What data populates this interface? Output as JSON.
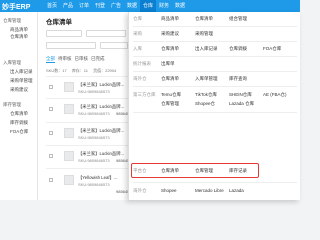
{
  "topbar": {
    "logo": "妙手ERP",
    "nav": [
      "首页",
      "产品",
      "订单",
      "刊登",
      "广告",
      "数据",
      "仓库",
      "财务",
      "数据"
    ]
  },
  "sidebar": {
    "groups": [
      {
        "label": "仓库管理",
        "items": [
          "商品清单",
          "仓库清单"
        ]
      },
      {
        "label": "入库管理",
        "items": [
          "出入库记录",
          "采购单管理",
          "采购建议"
        ]
      },
      {
        "label": "库存管理",
        "items": [
          "仓库清单",
          "库存调拨",
          "FOA仓库"
        ]
      }
    ]
  },
  "main": {
    "title": "仓库清单",
    "tabs": [
      "全部",
      "待审核",
      "已审核",
      "已完成"
    ],
    "stats": [
      "SKU数：17",
      "库存：11",
      "货值：22904"
    ],
    "products": [
      {
        "title": "【米兰家】Luckin品牌...",
        "sku": "SKU:9809846573",
        "value": "9856457155"
      },
      {
        "title": "【米兰家】Luckin品牌...",
        "sku": "SKU:9809846573",
        "value": "9856457155"
      },
      {
        "title": "【米兰家】Luckin品牌...",
        "sku": "SKU:9809846573",
        "value": "9856457155"
      },
      {
        "title": "【米兰家】Luckin品牌...",
        "sku": "SKU:9809846573",
        "value": "9856457155"
      },
      {
        "title": "【Yellowish Leaf】...",
        "sku": "SKU:9809846573",
        "value": "9856457155"
      }
    ]
  },
  "dropdown": {
    "sections": [
      {
        "category": "仓库",
        "items": [
          "商品清单",
          "仓库清单",
          "组合管理"
        ]
      },
      {
        "category": "采购",
        "items": [
          "采购建议",
          "采购管理"
        ]
      },
      {
        "category": "入库",
        "items": [
          "仓库清单",
          "出入库记录",
          "仓库调拨",
          "FOA仓库"
        ]
      },
      {
        "category": "统计报表",
        "items": [
          "出库单"
        ]
      },
      {
        "category": "海外仓",
        "items": [
          "仓库清单",
          "入库单管理",
          "库存查询"
        ]
      },
      {
        "category": "第三方仓库",
        "items": [
          "Temu仓库",
          "TikTok仓库",
          "SHEIN仓库",
          "AE (FBA仓)"
        ]
      },
      {
        "category": "",
        "items": [
          "仓库管理",
          "Shopee仓",
          "Lazada 仓库"
        ]
      },
      {
        "category": "平台仓",
        "items": [
          "仓库清单",
          "仓库管理",
          "库存记录"
        ]
      },
      {
        "category": "海外仓",
        "items": [
          "Shopee",
          "Mercado Libre",
          "Lazada"
        ]
      }
    ]
  }
}
